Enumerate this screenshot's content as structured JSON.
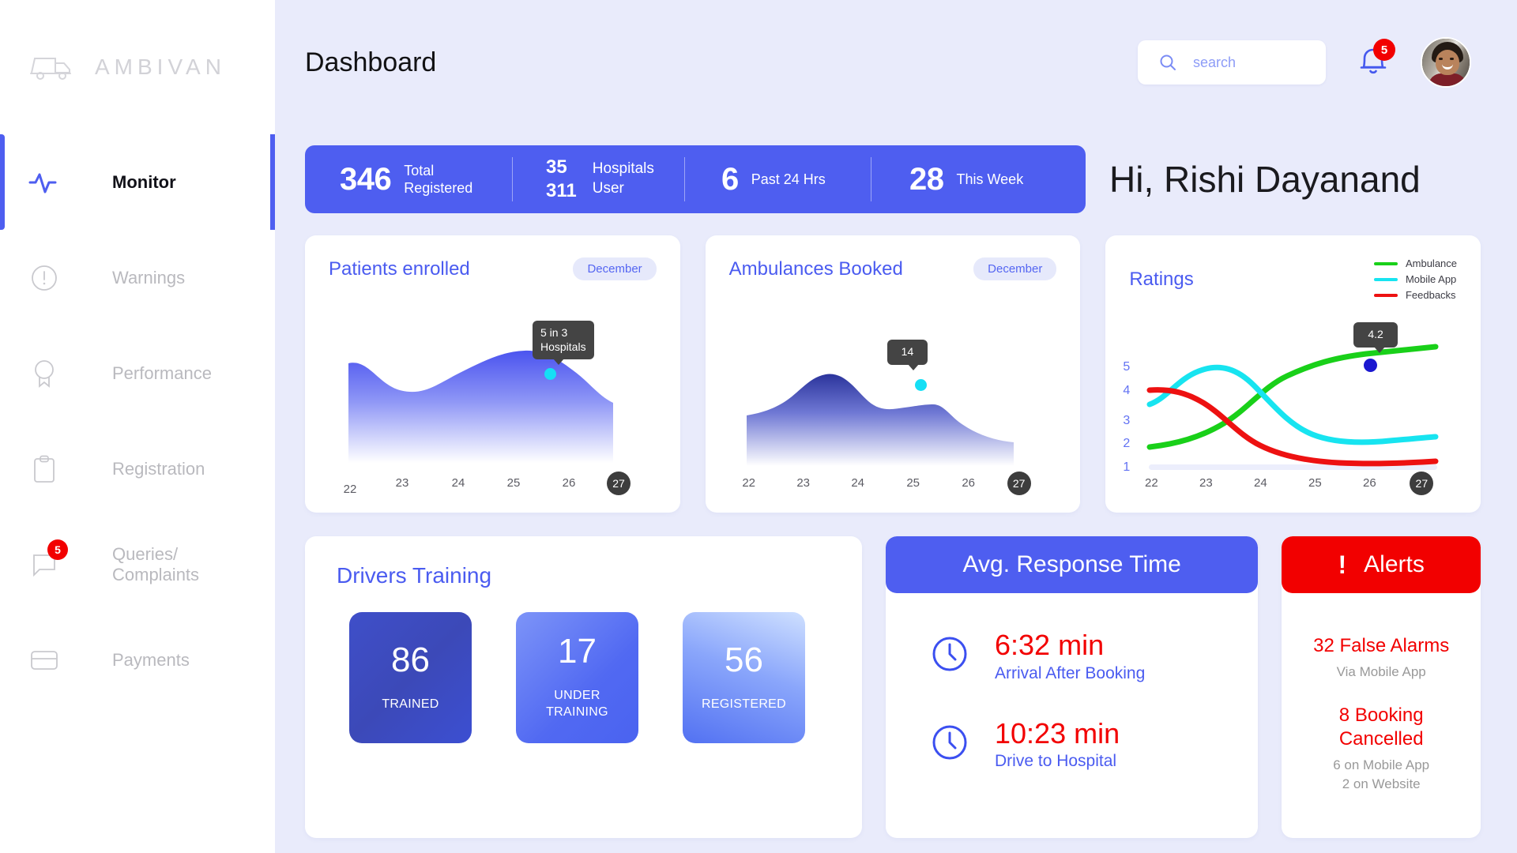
{
  "brand": {
    "name": "AMBIVAN",
    "icon": "ambulance-icon"
  },
  "sidebar": {
    "items": [
      {
        "label": "Monitor",
        "icon": "pulse-icon",
        "active": true,
        "badge": null
      },
      {
        "label": "Warnings",
        "icon": "alert-circle-icon",
        "active": false,
        "badge": null
      },
      {
        "label": "Performance",
        "icon": "award-icon",
        "active": false,
        "badge": null
      },
      {
        "label": "Registration",
        "icon": "clipboard-icon",
        "active": false,
        "badge": null
      },
      {
        "label": "Queries/\nComplaints",
        "icon": "chat-icon",
        "active": false,
        "badge": "5"
      },
      {
        "label": "Payments",
        "icon": "card-icon",
        "active": false,
        "badge": null
      }
    ]
  },
  "header": {
    "title": "Dashboard",
    "search": {
      "placeholder": "search",
      "value": "",
      "icon": "search-icon"
    },
    "notifications": {
      "count": "5",
      "icon": "bell-icon"
    },
    "avatar": "user-avatar"
  },
  "stats": {
    "items": [
      {
        "number": "346",
        "label": "Total\nRegistered"
      },
      {
        "numbers": "35\n311",
        "labels": "Hospitals\nUser"
      },
      {
        "number": "6",
        "label": "Past 24 Hrs"
      },
      {
        "number": "28",
        "label": "This Week"
      }
    ],
    "greeting": "Hi, Rishi Dayanand"
  },
  "chart_data": [
    {
      "type": "area",
      "title": "Patients enrolled",
      "badge": "December",
      "x": [
        22,
        23,
        24,
        25,
        26,
        27
      ],
      "xtick_labels": [
        "22",
        "23",
        "24",
        "25",
        "26",
        "27"
      ],
      "values": [
        62,
        46,
        52,
        72,
        68,
        42
      ],
      "ylabel": "",
      "xlabel": "",
      "grid": false,
      "legend": "none",
      "annotation": {
        "text": "5 in 3\nHospitals",
        "x": 26,
        "y": 68,
        "dot_color": "#15dff5"
      },
      "fill_top": "#4a56e8",
      "fill_bottom": "#ffffff"
    },
    {
      "type": "area",
      "title": "Ambulances Booked",
      "badge": "December",
      "x": [
        22,
        23,
        24,
        25,
        26,
        27
      ],
      "xtick_labels": [
        "22",
        "23",
        "24",
        "25",
        "26",
        "27"
      ],
      "values": [
        48,
        62,
        82,
        52,
        56,
        30
      ],
      "ylabel": "",
      "xlabel": "",
      "grid": false,
      "legend": "none",
      "annotation": {
        "text": "14",
        "x": 25,
        "y": 52,
        "dot_color": "#15dff5"
      },
      "fill_top": "#2e39a8",
      "fill_bottom": "#ffffff"
    },
    {
      "type": "line",
      "title": "Ratings",
      "x": [
        22,
        23,
        24,
        25,
        26,
        27
      ],
      "xtick_labels": [
        "22",
        "23",
        "24",
        "25",
        "26",
        "27"
      ],
      "ytick_labels": [
        "5",
        "4",
        "3",
        "2",
        "1"
      ],
      "ylim": [
        1,
        5
      ],
      "grid": false,
      "legend": "top-right",
      "series": [
        {
          "name": "Ambulance",
          "color": "#19d019",
          "values": [
            1.85,
            2.1,
            2.85,
            3.75,
            4.2,
            4.45
          ]
        },
        {
          "name": "Mobile App",
          "color": "#17e4f0",
          "values": [
            3.6,
            4.35,
            4.9,
            4.25,
            3.4,
            2.95
          ]
        },
        {
          "name": "Feedbacks",
          "color": "#ed1111",
          "values": [
            4.15,
            4.0,
            3.1,
            2.45,
            2.0,
            1.95
          ]
        }
      ],
      "annotation": {
        "text": "4.2",
        "x": 26,
        "y": 4.2,
        "dot_color": "#1b18d0"
      }
    }
  ],
  "training": {
    "title": "Drivers Training",
    "tiles": [
      {
        "value": "86",
        "label": "TRAINED"
      },
      {
        "value": "17",
        "label": "UNDER\nTRAINING"
      },
      {
        "value": "56",
        "label": "REGISTERED"
      }
    ]
  },
  "response_time": {
    "title": "Avg. Response Time",
    "rows": [
      {
        "value": "6:32 min",
        "label": "Arrival After Booking",
        "icon": "clock-icon"
      },
      {
        "value": "10:23 min",
        "label": "Drive to Hospital",
        "icon": "clock-icon"
      }
    ]
  },
  "alerts": {
    "title": "Alerts",
    "icon": "exclamation-icon",
    "blocks": [
      {
        "main": "32 False Alarms",
        "sub": "Via Mobile App"
      },
      {
        "main": "8 Booking\nCancelled",
        "sub": "6 on Mobile App\n2 on Website"
      }
    ]
  },
  "colors": {
    "accent": "#4e5ef0",
    "danger": "#f20000",
    "bg": "#e9ebfb",
    "cyan": "#15dff5",
    "green": "#19d019"
  }
}
